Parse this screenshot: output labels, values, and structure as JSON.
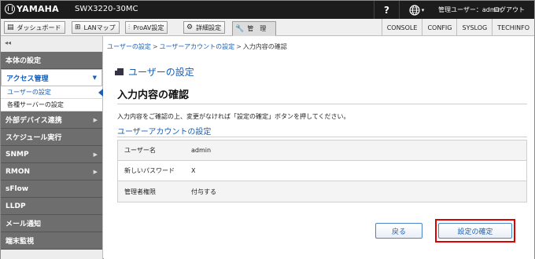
{
  "topbar": {
    "brand": "YAMAHA",
    "model": "SWX3220-30MC",
    "help_label": "?",
    "globe_caret": "▾",
    "user_info": "管理ユーザー：admin",
    "logout_label": "ログアウト"
  },
  "nav": {
    "buttons": [
      {
        "label": "ダッシュボード",
        "icon": "dashboard-icon"
      },
      {
        "label": "LANマップ",
        "icon": "lanmap-icon"
      },
      {
        "label": "ProAV設定",
        "icon": "sliders-icon"
      },
      {
        "label": "詳細設定",
        "icon": "gear-icon"
      },
      {
        "label": "管　理",
        "icon": "wrench-icon"
      }
    ],
    "links": [
      "CONSOLE",
      "CONFIG",
      "SYSLOG",
      "TECHINFO"
    ]
  },
  "sidebar": {
    "collapse_label": "◂◂",
    "items": [
      {
        "label": "本体の設定"
      },
      {
        "label": "アクセス管理",
        "open": true
      },
      {
        "label": "外部デバイス連携"
      },
      {
        "label": "スケジュール実行"
      },
      {
        "label": "SNMP"
      },
      {
        "label": "RMON"
      },
      {
        "label": "sFlow"
      },
      {
        "label": "LLDP"
      },
      {
        "label": "メール通知"
      },
      {
        "label": "端末監視"
      }
    ],
    "subitems": [
      "ユーザーの設定",
      "各種サーバーの設定"
    ]
  },
  "breadcrumb": {
    "link1": "ユーザーの設定",
    "link2": "ユーザーアカウントの設定",
    "current": "入力内容の確認",
    "sep": ">"
  },
  "page": {
    "title": "ユーザーの設定",
    "heading": "入力内容の確認",
    "description": "入力内容をご確認の上、変更がなければ「設定の確定」ボタンを押してください。",
    "section": "ユーザーアカウントの設定"
  },
  "table": [
    {
      "key": "ユーザー名",
      "value": "admin"
    },
    {
      "key": "新しいパスワード",
      "value": "X"
    },
    {
      "key": "管理者権限",
      "value": "付与する"
    }
  ],
  "buttons": {
    "back": "戻る",
    "confirm": "設定の確定"
  },
  "colors": {
    "accent": "#1a5fb4",
    "highlight": "#e00000"
  }
}
